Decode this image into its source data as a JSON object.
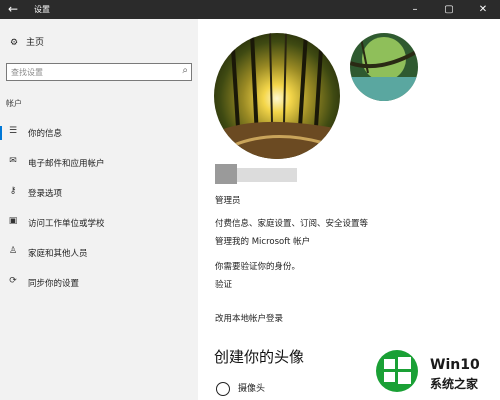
{
  "window": {
    "title": "设置",
    "back_icon": "back-arrow-icon"
  },
  "sidebar": {
    "home_label": "主页",
    "search_placeholder": "查找设置",
    "section_label": "帐户",
    "items": [
      {
        "label": "你的信息",
        "icon": "person-card-icon",
        "active": true
      },
      {
        "label": "电子邮件和应用帐户",
        "icon": "mail-icon"
      },
      {
        "label": "登录选项",
        "icon": "key-icon"
      },
      {
        "label": "访问工作单位或学校",
        "icon": "briefcase-icon"
      },
      {
        "label": "家庭和其他人员",
        "icon": "person-icon"
      },
      {
        "label": "同步你的设置",
        "icon": "sync-icon"
      }
    ]
  },
  "main": {
    "account_type": "管理员",
    "billing_link": "付费信息、家庭设置、订阅、安全设置等",
    "manage_account_link": "管理我的 Microsoft 帐户",
    "verify_prompt": "你需要验证你的身份。",
    "verify_link": "验证",
    "local_login_link": "改用本地帐户登录",
    "create_avatar_heading": "创建你的头像",
    "camera_label": "摄像头"
  },
  "watermark": {
    "brand": "Win10",
    "site": "系统之家"
  },
  "colors": {
    "accent": "#0078d7",
    "titlebar": "#2b2b2b",
    "sidebar_bg": "#f2f2f2",
    "watermark_green": "#1aa035"
  }
}
